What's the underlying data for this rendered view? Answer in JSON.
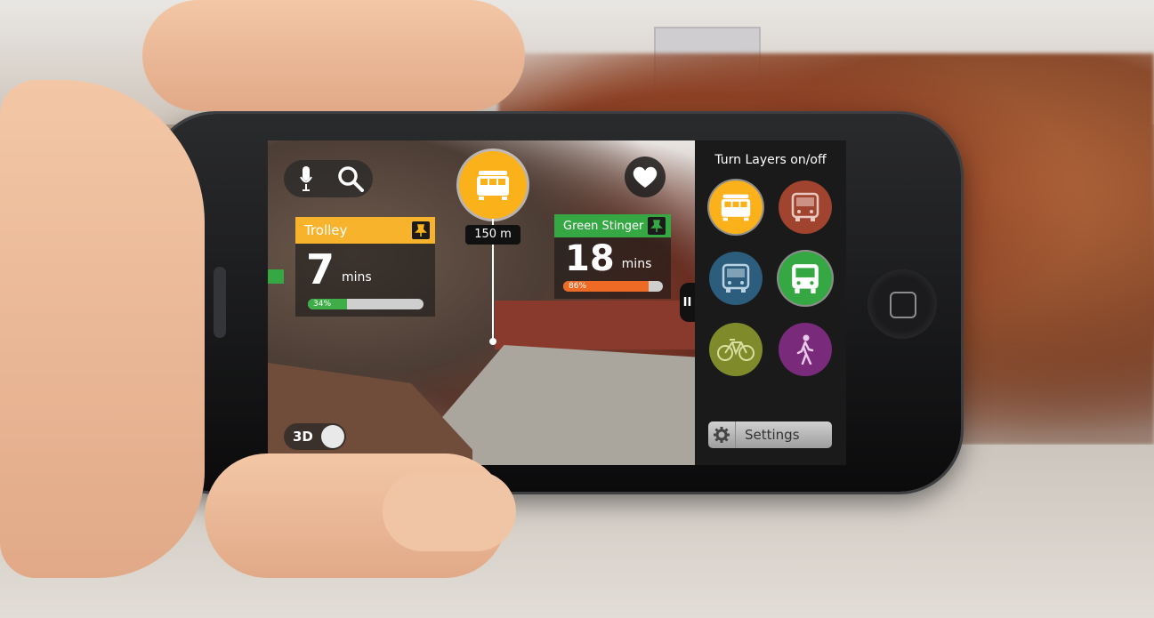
{
  "camera_view": {
    "search": {
      "mic_icon": "microphone-icon",
      "search_icon": "search-icon"
    },
    "favorite_icon": "heart-icon",
    "marker": {
      "icon": "trolley-icon",
      "distance": "150 m",
      "color": "#fbb21a"
    },
    "cards": [
      {
        "name": "Trolley",
        "minutes": "7",
        "minutes_label": "mins",
        "progress_label": "34%",
        "progress": 0.34,
        "header_color": "#f7b32c",
        "bar_color": "#3fae49"
      },
      {
        "name": "Green Stinger",
        "minutes": "18",
        "minutes_label": "mins",
        "progress_label": "86%",
        "progress": 0.86,
        "header_color": "#36a843",
        "bar_color": "#ef6a24"
      }
    ],
    "toggle_3d": {
      "label": "3D",
      "on": false
    },
    "pause_icon": "pause-icon"
  },
  "layers_panel": {
    "title": "Turn Layers on/off",
    "layers": [
      {
        "name": "trolley",
        "icon": "trolley-icon",
        "color": "#fbb21a",
        "active": true
      },
      {
        "name": "bus-red",
        "icon": "bus-icon",
        "color": "#a0432f",
        "active": false
      },
      {
        "name": "bus-blue",
        "icon": "bus-icon",
        "color": "#2c5d7c",
        "active": false
      },
      {
        "name": "bus-green",
        "icon": "bus-icon",
        "color": "#36a843",
        "active": true
      },
      {
        "name": "bike",
        "icon": "bicycle-icon",
        "color": "#7f8b2a",
        "active": false
      },
      {
        "name": "walk",
        "icon": "pedestrian-icon",
        "color": "#7a2a7a",
        "active": false
      }
    ],
    "settings_label": "Settings",
    "settings_icon": "gear-icon"
  }
}
